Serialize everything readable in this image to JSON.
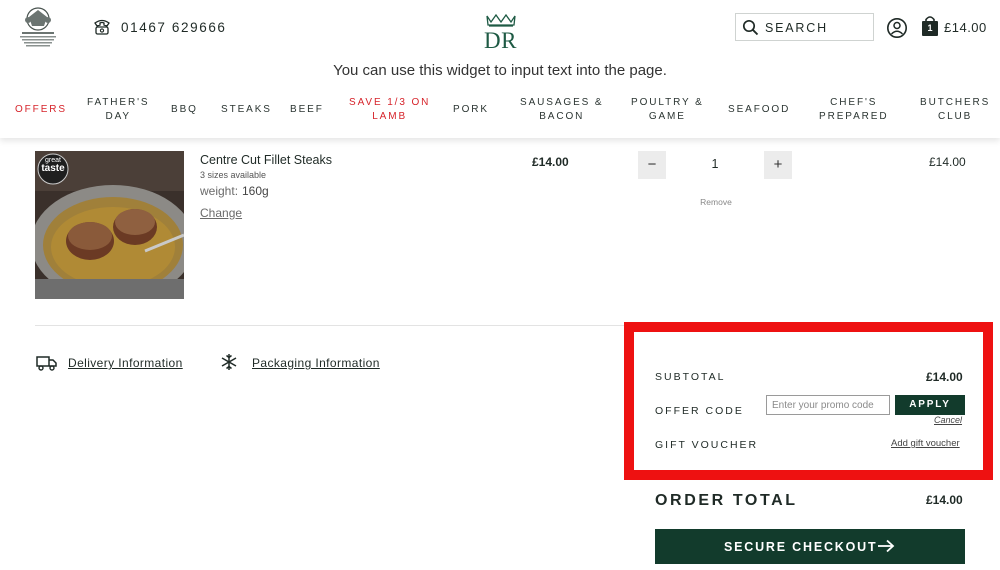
{
  "header": {
    "phone": "01467 629666",
    "logo_text": "DR",
    "search_label": "SEARCH",
    "basket_count": "1",
    "basket_total": "£14.00",
    "widget_notice": "You can use this widget to input text into the page."
  },
  "nav": {
    "items": [
      {
        "label": "OFFERS",
        "color": "#d6232a"
      },
      {
        "label": "FATHER'S\nDAY"
      },
      {
        "label": "BBQ"
      },
      {
        "label": "STEAKS"
      },
      {
        "label": "BEEF"
      },
      {
        "label": "SAVE 1/3 ON\nLAMB",
        "color": "#d6232a"
      },
      {
        "label": "PORK"
      },
      {
        "label": "SAUSAGES &\nBACON"
      },
      {
        "label": "POULTRY &\nGAME"
      },
      {
        "label": "SEAFOOD"
      },
      {
        "label": "CHEF'S\nPREPARED"
      },
      {
        "label": "BUTCHERS\nCLUB"
      }
    ]
  },
  "cart": {
    "item": {
      "badge_icon": "great-taste-award-badge",
      "name": "Centre Cut Fillet Steaks",
      "sizes": "3 sizes available",
      "weight_label": "weight:",
      "weight_value": "160g",
      "change_label": "Change",
      "unit_price": "£14.00",
      "quantity": "1",
      "minus": "−",
      "plus": "+",
      "remove_label": "Remove",
      "line_total": "£14.00"
    },
    "links": {
      "delivery": "Delivery Information",
      "packaging": "Packaging Information"
    }
  },
  "summary": {
    "subtotal_label": "SUBTOTAL",
    "subtotal_value": "£14.00",
    "offer_label": "OFFER CODE",
    "promo_placeholder": "Enter your promo code",
    "apply_label": "APPLY",
    "cancel_label": "Cancel",
    "gift_label": "GIFT VOUCHER",
    "gift_link": "Add gift voucher",
    "order_total_label": "ORDER TOTAL",
    "order_total_value": "£14.00",
    "checkout_label": "SECURE CHECKOUT"
  },
  "colors": {
    "brand_green": "#123b2c",
    "accent_red": "#d6232a",
    "highlight_red": "#ee1111"
  }
}
